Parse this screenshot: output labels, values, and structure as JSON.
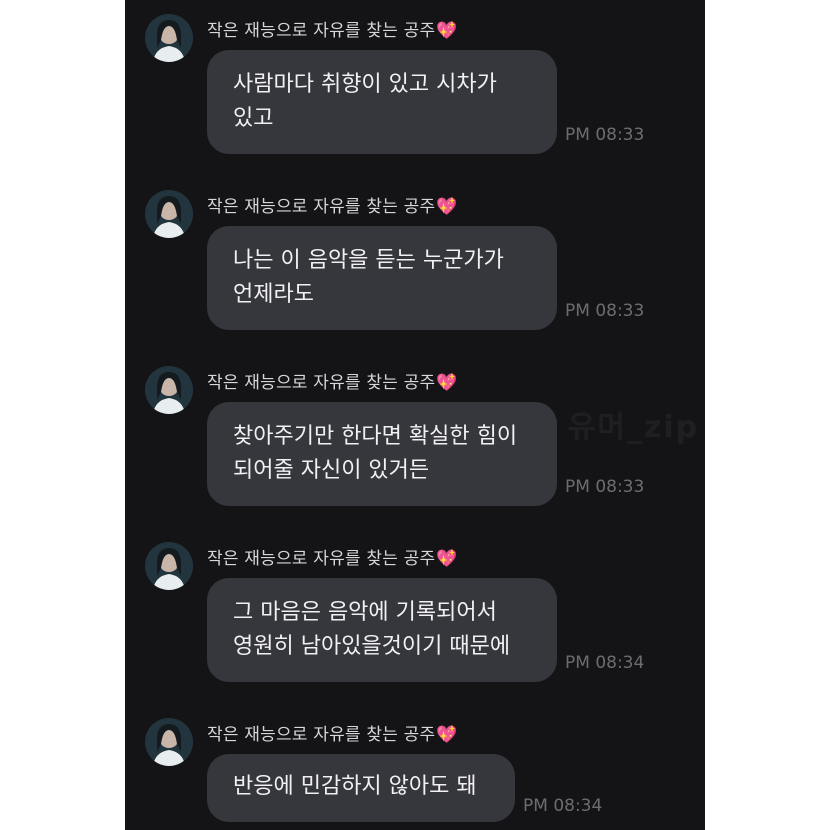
{
  "sender": {
    "name": "작은 재능으로 자유를 찾는 공주",
    "name_emoji": "💖"
  },
  "messages": [
    {
      "text": "사람마다 취향이 있고 시차가\n있고",
      "time": "PM 08:33"
    },
    {
      "text": "나는 이 음악을 듣는 누군가가\n언제라도",
      "time": "PM 08:33"
    },
    {
      "text": "찾아주기만 한다면 확실한 힘이\n되어줄 자신이 있거든",
      "time": "PM 08:33"
    },
    {
      "text": "그 마음은 음악에 기록되어서\n영원히 남아있을것이기 때문에",
      "time": "PM 08:34"
    },
    {
      "text": "반응에 민감하지 않아도 돼",
      "time": "PM 08:34"
    }
  ],
  "watermark": "유머_zip 유머_zip 유머_zip 유머_zip",
  "colors": {
    "background": "#141416",
    "bubble": "#36373d",
    "heart": "#ff5aa8"
  }
}
